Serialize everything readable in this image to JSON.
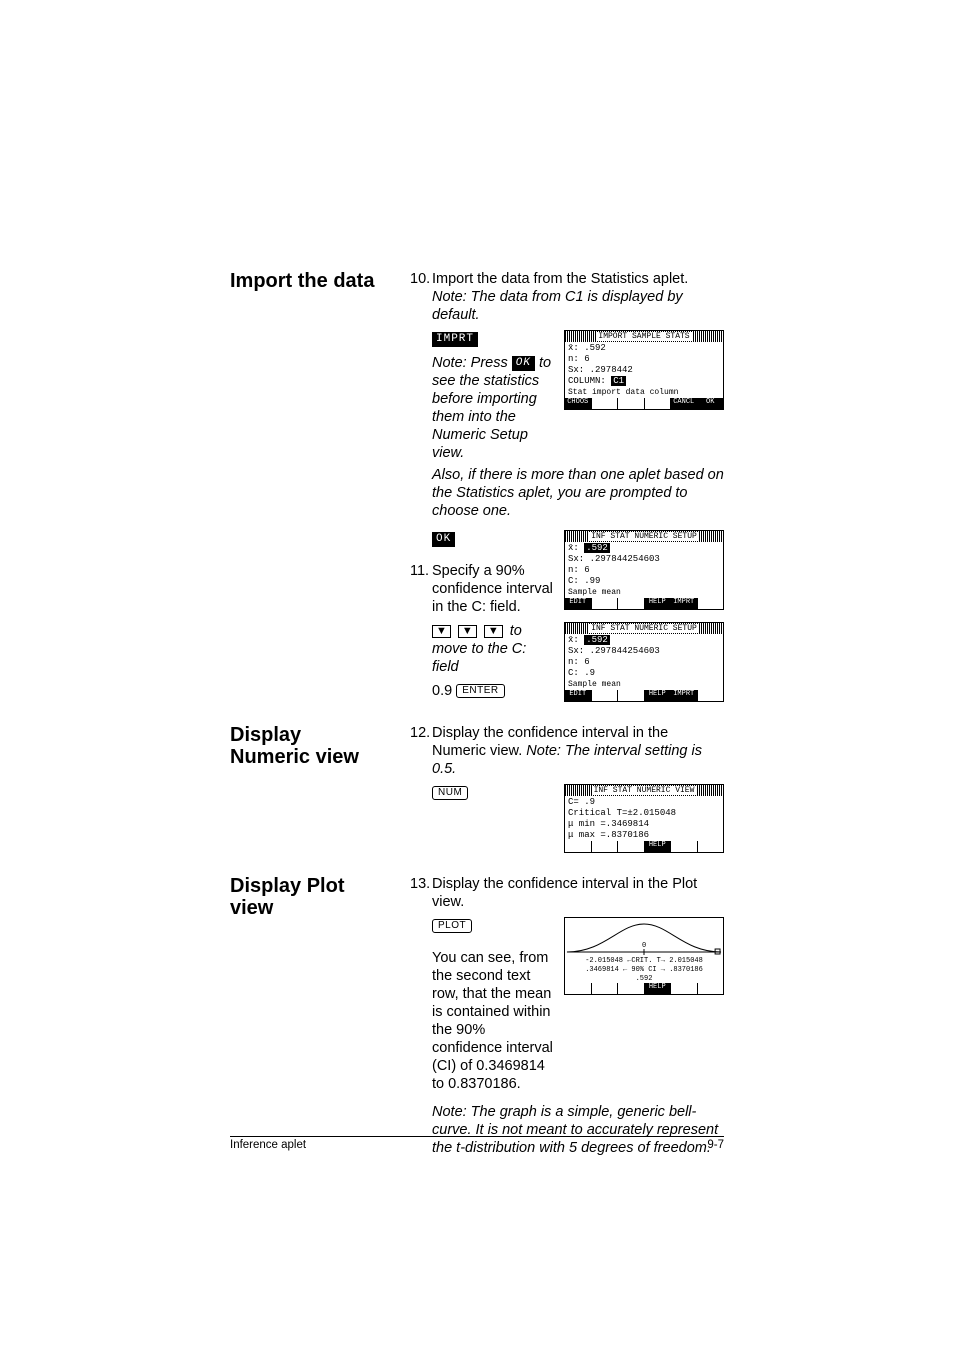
{
  "section_import_heading": "Import the data",
  "section_numeric_heading": "Display Numeric view",
  "section_plot_heading": "Display Plot view",
  "step10": {
    "num": "10.",
    "txt": "Import the data from the Statistics aplet. "
  },
  "step10_note": "Note: The data from C1 is displayed by default.",
  "soft_imprt": "IMPRT",
  "soft_ok": "OK",
  "soft_edit": "EDIT",
  "soft_help": "HELP",
  "soft_choos": "CHOOS",
  "soft_cancl": "CANCL",
  "press_ok_note_1": "Note: Press ",
  "press_ok_note_2": " to see the statistics before importing them into the Numeric Setup view.",
  "press_ok_tail": "Also, if there is more than one aplet based on the Statistics aplet, you are prompted to choose one.",
  "step11": {
    "num": "11.",
    "txt": "Specify a 90% confidence interval in the C: field."
  },
  "move_to_c_1": " to move to the C: field",
  "c_value_label": "0.9 ",
  "key_enter": "ENTER",
  "key_num": "NUM",
  "key_plot": "PLOT",
  "step12": {
    "num": "12.",
    "txt": "Display the confidence interval in the Numeric view. "
  },
  "step12_note": "Note: The interval setting is 0.5.",
  "step13": {
    "num": "13.",
    "txt": "Display the confidence interval in the Plot view."
  },
  "plot_para_1": "You can see, from the second text row, that the mean is contained within the 90% confidence interval (CI) of 0.3469814 to 0.8370186.",
  "plot_note": "Note: The graph is a simple, generic bell-curve. It is not meant to accurately represent the t-distribution with 5 degrees of freedom.",
  "screens": {
    "import_stats": {
      "title": "IMPORT SAMPLE STATS",
      "lines": {
        "xbar": "x̄:  .592",
        "n": "n:  6",
        "sx": "Sx: .2978442",
        "col": "COLUMN: ",
        "col_val": "C1"
      },
      "help": "Stat import data column",
      "bottom": [
        "CHOOS",
        "",
        "",
        "",
        "CANCL",
        "OK"
      ]
    },
    "setup_c99": {
      "title": "INF STAT NUMERIC SETUP",
      "lines": {
        "xbar_hi": ".592",
        "sx": "Sx: .297844254603",
        "n": "n:  6",
        "c": "C:  .99"
      },
      "help": "Sample mean",
      "bottom": [
        "EDIT",
        "",
        "",
        "HELP",
        "IMPRT",
        ""
      ]
    },
    "setup_c9": {
      "title": "INF STAT NUMERIC SETUP",
      "lines": {
        "xbar_hi": ".592",
        "sx": "Sx: .297844254603",
        "n": "n:  6",
        "c": "C:  .9"
      },
      "help": "Sample mean",
      "bottom": [
        "EDIT",
        "",
        "",
        "HELP",
        "IMPRT",
        ""
      ]
    },
    "numeric_view": {
      "title": "INF STAT NUMERIC VIEW",
      "lines": {
        "c": "         C= .9",
        "crit": "Critical T=±2.015048",
        "umin": "     μ min =.3469814",
        "umax": "     μ max =.8370186"
      },
      "bottom": [
        "",
        "",
        "",
        "HELP",
        "",
        ""
      ]
    },
    "plot_view": {
      "line1": "-2.015048 ←CRIT. T→ 2.015048",
      "line2": ".3469814 ← 90% CI → .8370186",
      "line3": ".592",
      "bottom": [
        "",
        "",
        "",
        "HELP",
        "",
        ""
      ]
    }
  },
  "chart_data": {
    "type": "line",
    "title": "Confidence interval bell curve (generic)",
    "description": "Normal‑shaped curve with central tick at 0; annotations show critical T values and CI bounds",
    "x_center_tick_label": "0",
    "critical_t_low": -2.015048,
    "critical_t_high": 2.015048,
    "ci_low": 0.3469814,
    "ci_high": 0.8370186,
    "ci_pct": 90,
    "sample_mean": 0.592
  },
  "footer_left": "Inference aplet",
  "footer_right": "9-7"
}
